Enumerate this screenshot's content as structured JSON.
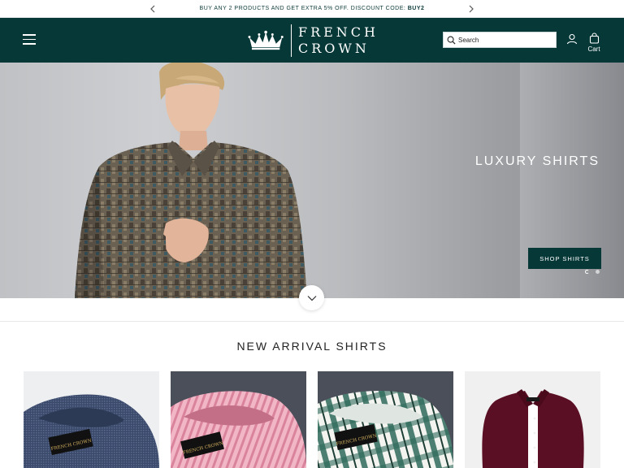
{
  "announcement": {
    "text": "BUY ANY 2 PRODUCTS AND GET EXTRA 5% OFF. DISCOUNT CODE: ",
    "code": "BUY2"
  },
  "header": {
    "brand_line1": "FRENCH",
    "brand_line2": "CROWN",
    "search_placeholder": "Search",
    "cart_label": "Cart"
  },
  "hero": {
    "title": "LUXURY SHIRTS",
    "cta_label": "SHOP SHIRTS",
    "slides": 2,
    "active_slide": 1
  },
  "new_arrivals": {
    "title": "NEW ARRIVAL SHIRTS",
    "products": [
      {
        "color": "#3b4a6b",
        "label": "FRENCH CROWN"
      },
      {
        "color": "#e8a0b4",
        "label": "FRENCH CROWN"
      },
      {
        "color": "#2f6b5a",
        "label": "FRENCH CROWN"
      },
      {
        "color": "#5a0f24",
        "label": ""
      }
    ]
  },
  "colors": {
    "brand_dark": "#073838",
    "white": "#ffffff"
  }
}
